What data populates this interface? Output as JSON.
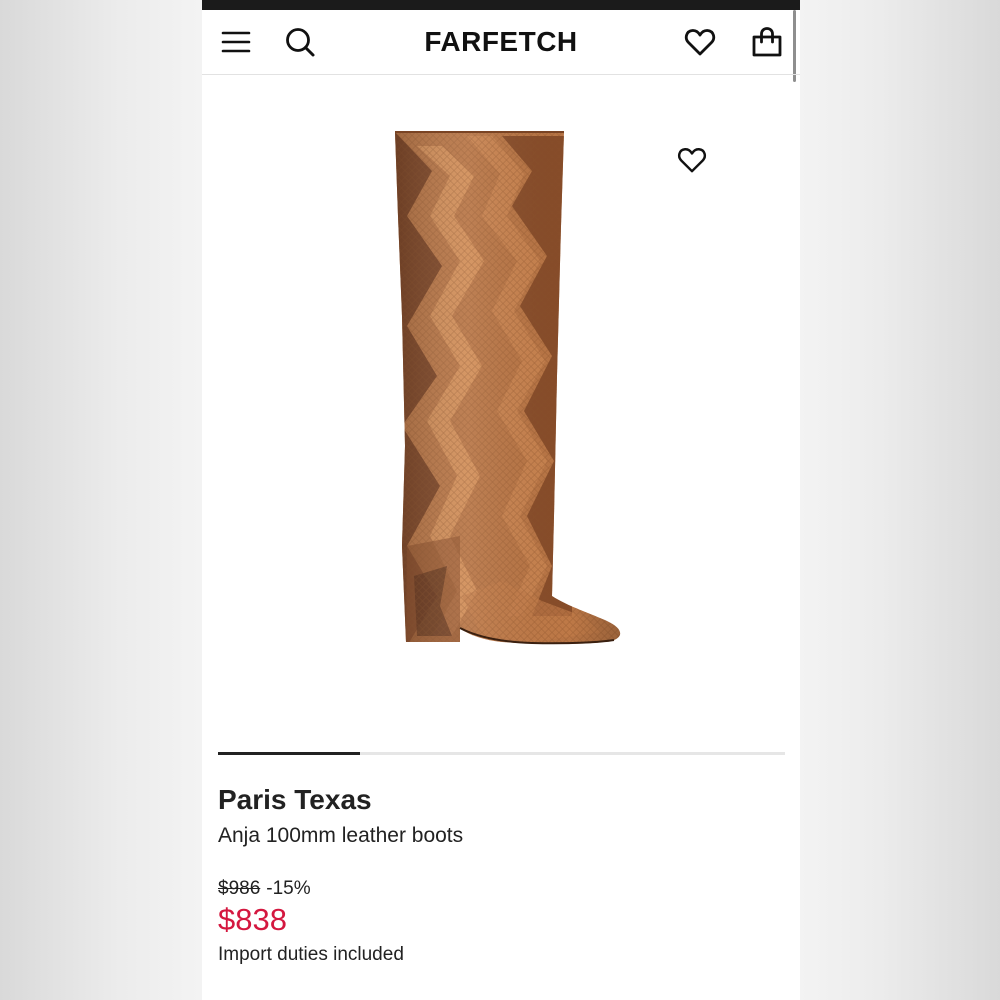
{
  "header": {
    "logo": "FARFETCH",
    "icons": [
      "menu-icon",
      "search-icon",
      "heart-icon",
      "bag-icon"
    ]
  },
  "product": {
    "brand": "Paris Texas",
    "name": "Anja 100mm leather boots",
    "original_price": "$986",
    "discount": "-15%",
    "price": "$838",
    "duties_note": "Import duties included",
    "image_subject": "tan python-print knee-high boot"
  },
  "gallery": {
    "progress": 0.25
  },
  "colors": {
    "sale_price": "#d4173f",
    "text": "#222222",
    "boot": "#b87545"
  }
}
